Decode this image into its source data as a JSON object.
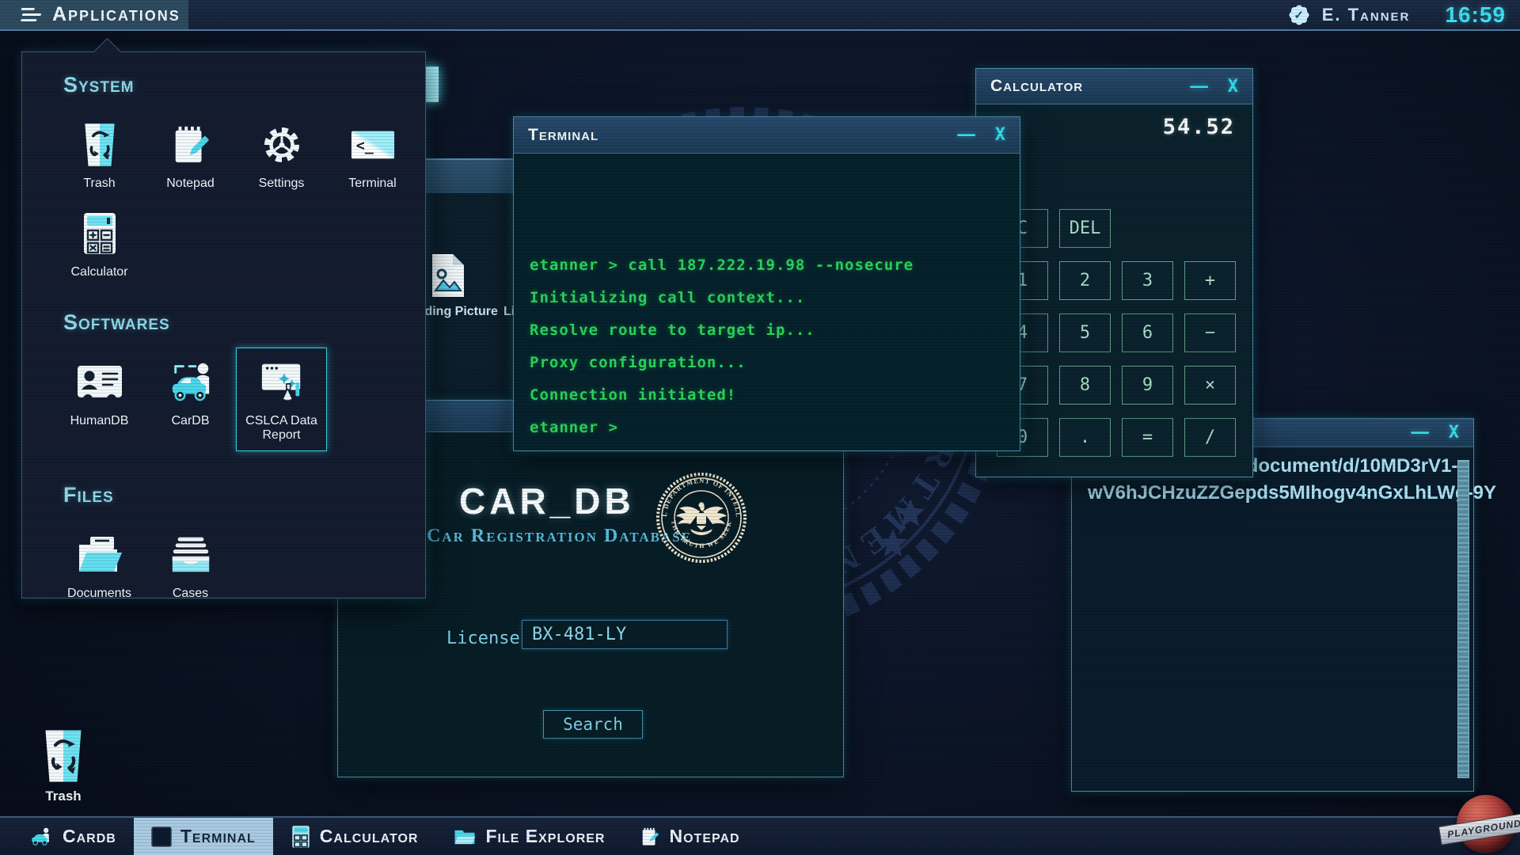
{
  "topbar": {
    "menu_label": "Applications",
    "user_name": "E. Tanner",
    "clock": "16:59"
  },
  "apps_menu": {
    "sections": [
      {
        "title": "System",
        "items": [
          {
            "label": "Trash"
          },
          {
            "label": "Notepad"
          },
          {
            "label": "Settings"
          },
          {
            "label": "Terminal"
          },
          {
            "label": "Calculator"
          }
        ]
      },
      {
        "title": "Softwares",
        "items": [
          {
            "label": "HumanDB"
          },
          {
            "label": "CarDB"
          },
          {
            "label": "CSLCA Data Report"
          }
        ]
      },
      {
        "title": "Files",
        "items": [
          {
            "label": "Documents"
          },
          {
            "label": "Cases"
          }
        ]
      }
    ]
  },
  "windows": {
    "terminal": {
      "title": "Terminal",
      "minimize": "–",
      "close": "X",
      "lines": [
        "etanner > call 187.222.19.98 --nosecure",
        "Initializing call context...",
        "Resolve route to target ip...",
        "Proxy configuration...",
        "Connection initiated!",
        "etanner >"
      ]
    },
    "calculator": {
      "title": "Calculator",
      "minimize": "–",
      "close": "X",
      "display": "54.52",
      "rows": [
        [
          "C",
          "DEL"
        ],
        [
          "1",
          "2",
          "3",
          "+"
        ],
        [
          "4",
          "5",
          "6",
          "−"
        ],
        [
          "7",
          "8",
          "9",
          "×"
        ],
        [
          "0",
          ".",
          "=",
          "/"
        ]
      ]
    },
    "cardb": {
      "title": "CAR_DB",
      "subtitle": "Car Registration Database",
      "seal_top": "FEDERAL DEPARTMENT OF INTELLIGENCE",
      "seal_bottom": "· THE TRUTH WE SEEK ·",
      "license_label": "License",
      "license_value": "BX-481-LY",
      "search_label": "Search"
    },
    "notepad": {
      "minimize": "–",
      "close": "X",
      "lines": [
        "/document/d/10MD3rV1-",
        "wV6hJCHzuZZGepds5MIhogv4nGxLhLWg-9Y"
      ]
    },
    "file_explorer": {
      "file_labels": [
        "lding Picture",
        "Li"
      ]
    }
  },
  "desktop": {
    "trash_label": "Trash",
    "emblem_text": "FEDERAL DEPARTMENT OF INTELLIGENCE ★ ★ THE TRUTH WE SEEK ★ ★"
  },
  "taskbar": {
    "items": [
      {
        "label": "Cardb"
      },
      {
        "label": "Terminal"
      },
      {
        "label": "Calculator"
      },
      {
        "label": "File Explorer"
      },
      {
        "label": "Notepad"
      }
    ]
  },
  "logo_text": "PLAYGROUND",
  "colors": {
    "accent_cyan": "#3fdef0",
    "terminal_green": "#2bd45a",
    "calc_key_teal": "#a8dcc6",
    "seal_cream": "#efe6cf",
    "taskbar_active": "#a9cae2",
    "window_border": "#4d86a0"
  }
}
